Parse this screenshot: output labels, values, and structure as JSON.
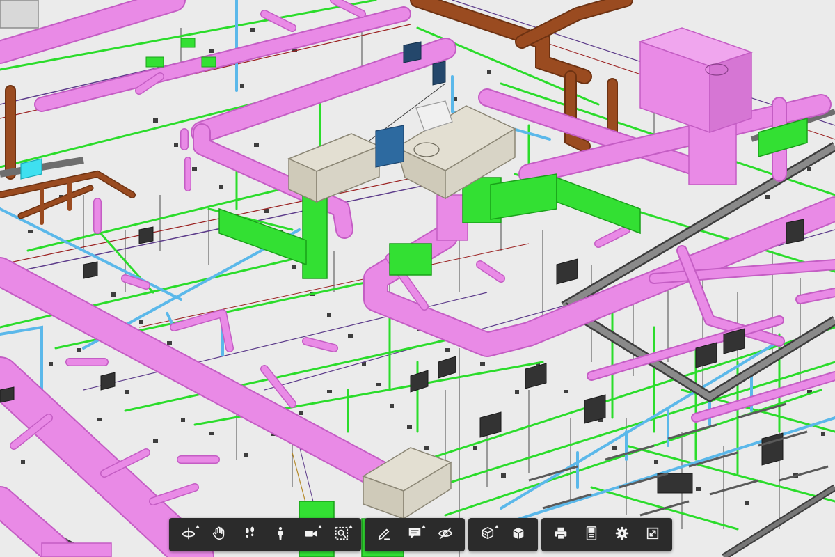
{
  "viewer": {
    "colors": {
      "background": "#ebebeb",
      "duct_pink": "#e98ae6",
      "duct_pink_edge": "#c45dc4",
      "pipe_green": "#2bdc2b",
      "pipe_green_edge": "#19a019",
      "pipe_blue": "#5bb8ea",
      "pipe_brown": "#9a4b20",
      "pipe_brown_edge": "#6d3212",
      "air_unit_beige": "#d8d4c6",
      "air_unit_edge": "#8b8675",
      "tray_gray": "#6e6e6e",
      "tray_dark": "#3d3d3d",
      "equipment_blue": "#2d6aa0",
      "equipment_cyan": "#3fe0f0",
      "toolbar_bg": "#2b2b2b",
      "toolbar_icon": "#f2f2f2"
    }
  },
  "toolbar": {
    "groups": [
      {
        "name": "navigation",
        "buttons": [
          {
            "icon": "orbit-icon",
            "has_menu": true
          },
          {
            "icon": "pan-hand-icon",
            "has_menu": false
          },
          {
            "icon": "walk-footprints-icon",
            "has_menu": false
          },
          {
            "icon": "first-person-icon",
            "has_menu": false
          },
          {
            "icon": "camera-icon",
            "has_menu": true
          },
          {
            "icon": "fit-to-view-icon",
            "has_menu": true
          }
        ]
      },
      {
        "name": "review",
        "buttons": [
          {
            "icon": "markup-pen-icon",
            "has_menu": false
          },
          {
            "icon": "comment-icon",
            "has_menu": true
          },
          {
            "icon": "hide-eye-icon",
            "has_menu": false
          }
        ]
      },
      {
        "name": "model",
        "buttons": [
          {
            "icon": "section-box-icon",
            "has_menu": true
          },
          {
            "icon": "explode-cube-icon",
            "has_menu": false
          }
        ]
      },
      {
        "name": "settings",
        "buttons": [
          {
            "icon": "print-icon",
            "has_menu": false
          },
          {
            "icon": "model-browser-icon",
            "has_menu": false
          },
          {
            "icon": "settings-gear-icon",
            "has_menu": false
          },
          {
            "icon": "fullscreen-icon",
            "has_menu": false
          }
        ]
      }
    ]
  }
}
